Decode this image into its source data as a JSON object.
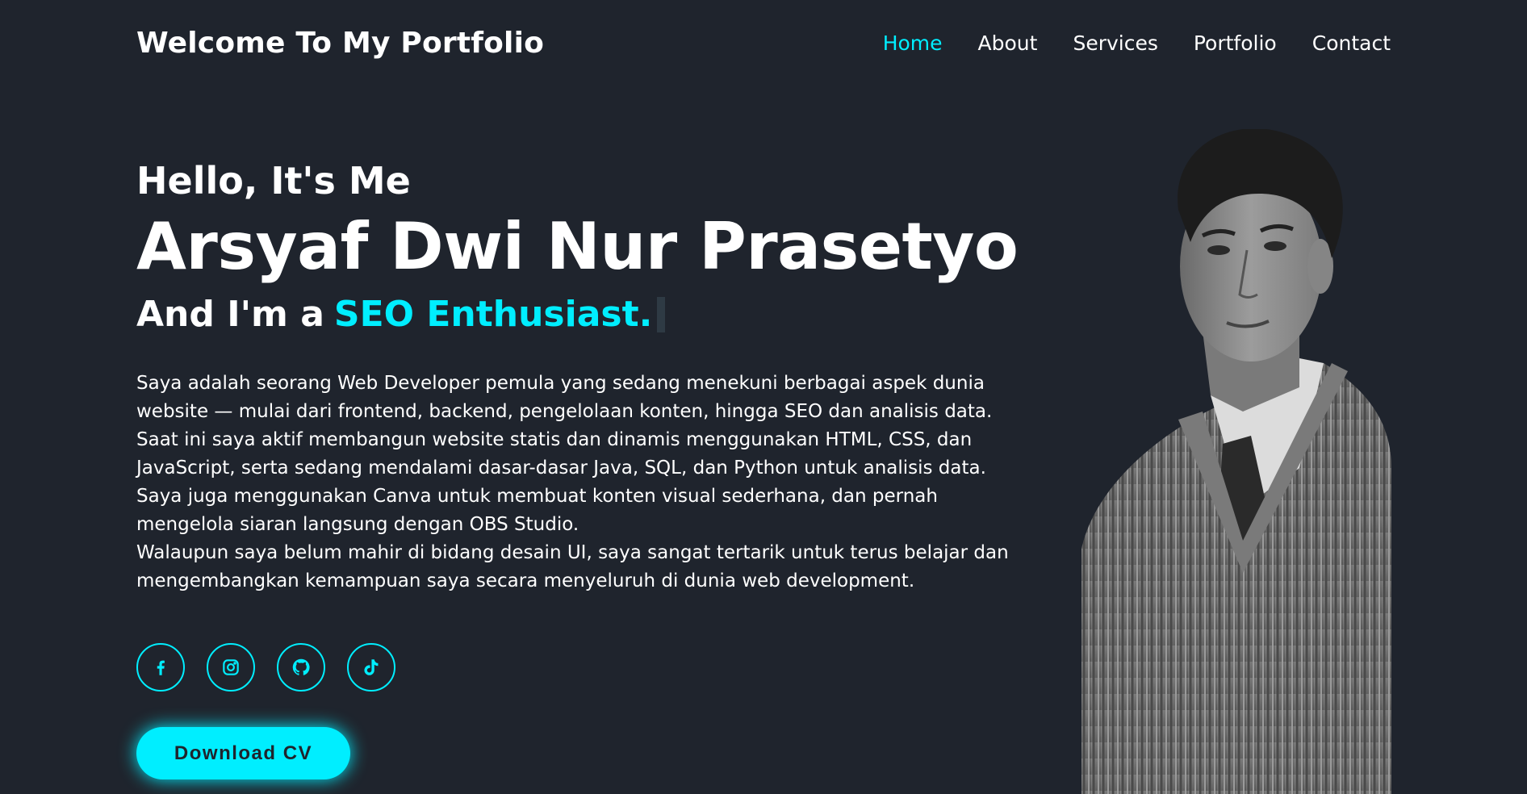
{
  "header": {
    "logo": "Welcome To My Portfolio",
    "nav": [
      {
        "label": "Home",
        "active": true
      },
      {
        "label": "About",
        "active": false
      },
      {
        "label": "Services",
        "active": false
      },
      {
        "label": "Portfolio",
        "active": false
      },
      {
        "label": "Contact",
        "active": false
      }
    ]
  },
  "hero": {
    "greeting": "Hello, It's Me",
    "name": "Arsyaf Dwi Nur Prasetyo",
    "role_prefix": "And I'm a",
    "role_accent": "SEO Enthusiast.",
    "description_lines": [
      "Saya adalah seorang Web Developer pemula yang sedang menekuni berbagai aspek dunia",
      "website — mulai dari frontend, backend, pengelolaan konten, hingga SEO dan analisis data.",
      "Saat ini saya aktif membangun website statis dan dinamis menggunakan HTML, CSS, dan",
      "JavaScript, serta sedang mendalami dasar-dasar Java, SQL, dan Python untuk analisis data.",
      "Saya juga menggunakan Canva untuk membuat konten visual sederhana, dan pernah",
      "mengelola siaran langsung dengan OBS Studio.",
      "Walaupun saya belum mahir di bidang desain UI, saya sangat tertarik untuk terus belajar dan",
      "mengembangkan kemampuan saya secara menyeluruh di dunia web development."
    ],
    "socials": [
      {
        "icon": "facebook-icon"
      },
      {
        "icon": "instagram-icon"
      },
      {
        "icon": "github-icon"
      },
      {
        "icon": "tiktok-icon"
      }
    ],
    "cv_button": "Download CV"
  },
  "colors": {
    "background": "#1f242d",
    "accent": "#00eeff",
    "text": "#ffffff"
  }
}
